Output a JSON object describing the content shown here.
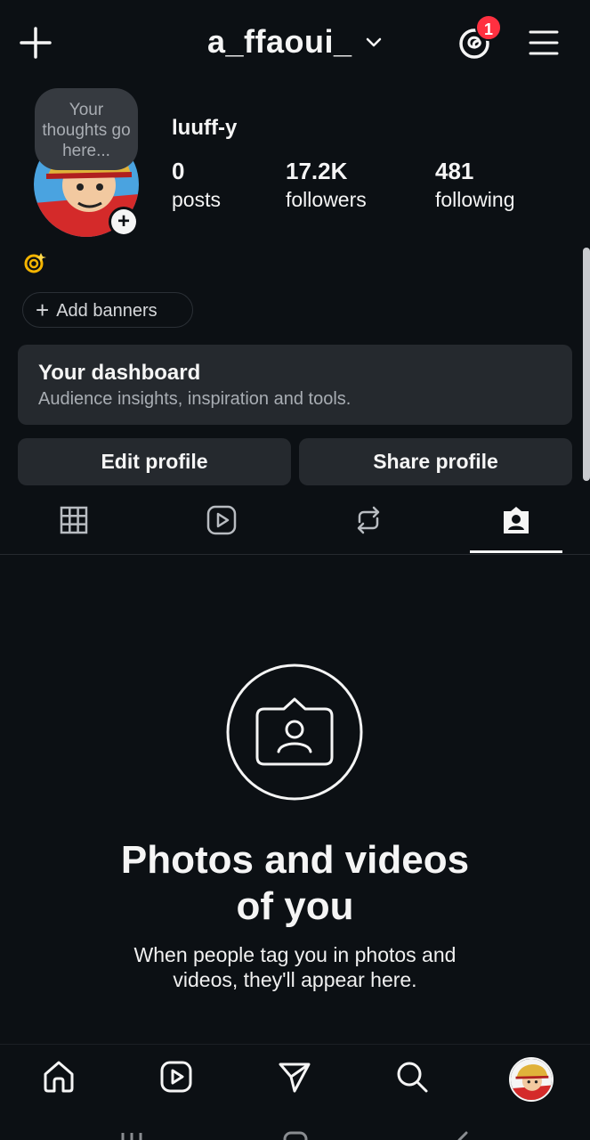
{
  "header": {
    "username": "a_ffaoui_",
    "notification_count": "1"
  },
  "profile": {
    "thought_bubble": "Your thoughts go here...",
    "display_name": "luuff-y",
    "stats": [
      {
        "value": "0",
        "label": "posts"
      },
      {
        "value": "17.2K",
        "label": "followers"
      },
      {
        "value": "481",
        "label": "following"
      }
    ],
    "bio_emoji": "💫",
    "add_banners": "Add banners"
  },
  "dashboard": {
    "title": "Your dashboard",
    "subtitle": "Audience insights, inspiration and tools."
  },
  "buttons": {
    "edit": "Edit profile",
    "share": "Share profile"
  },
  "tabs": {
    "icons": [
      "grid-icon",
      "reels-icon",
      "reposts-icon",
      "tagged-icon"
    ],
    "active_index": 3
  },
  "empty_state": {
    "title": "Photos and videos of you",
    "subtitle": "When people tag you in photos and videos, they'll appear here."
  },
  "bottom_nav": {
    "icons": [
      "home-icon",
      "reels-icon",
      "send-icon",
      "search-icon",
      "profile-avatar"
    ]
  },
  "colors": {
    "background": "#0c1014",
    "card": "#25292e",
    "badge": "#ff3040",
    "text": "#f5f5f5"
  }
}
